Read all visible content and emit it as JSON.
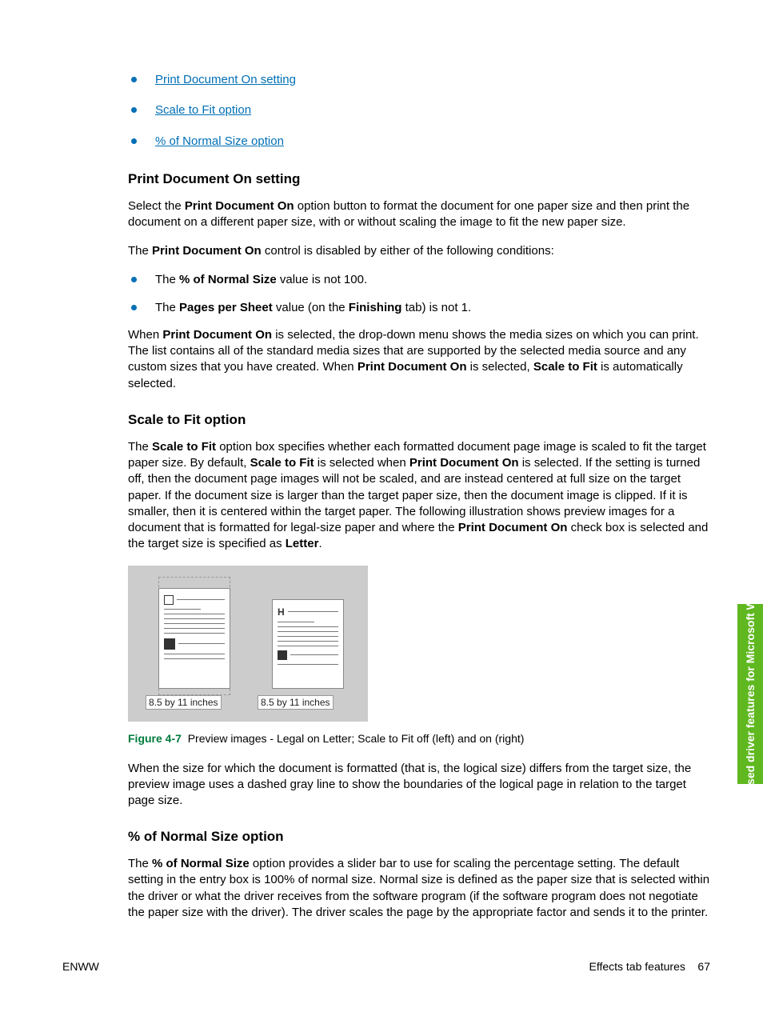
{
  "toc": {
    "items": [
      {
        "label": "Print Document On setting"
      },
      {
        "label": "Scale to Fit option"
      },
      {
        "label": "% of Normal Size option"
      }
    ]
  },
  "section1": {
    "heading": "Print Document On setting",
    "p1_a": "Select the ",
    "p1_b": "Print Document On",
    "p1_c": " option button to format the document for one paper size and then print the document on a different paper size, with or without scaling the image to fit the new paper size.",
    "p2_a": "The ",
    "p2_b": "Print Document On",
    "p2_c": " control is disabled by either of the following conditions:",
    "li1_a": "The ",
    "li1_b": "% of Normal Size",
    "li1_c": " value is not 100.",
    "li2_a": "The ",
    "li2_b": "Pages per Sheet",
    "li2_c": " value (on the ",
    "li2_d": "Finishing",
    "li2_e": " tab) is not 1.",
    "p3_a": "When ",
    "p3_b": "Print Document On",
    "p3_c": " is selected, the drop-down menu shows the media sizes on which you can print. The list contains all of the standard media sizes that are supported by the selected media source and any custom sizes that you have created. When ",
    "p3_d": "Print Document On",
    "p3_e": " is selected, ",
    "p3_f": "Scale to Fit",
    "p3_g": " is automatically selected."
  },
  "section2": {
    "heading": "Scale to Fit option",
    "p1_a": "The ",
    "p1_b": "Scale to Fit",
    "p1_c": " option box specifies whether each formatted document page image is scaled to fit the target paper size. By default, ",
    "p1_d": "Scale to Fit",
    "p1_e": " is selected when ",
    "p1_f": "Print Document On",
    "p1_g": " is selected. If the setting is turned off, then the document page images will not be scaled, and are instead centered at full size on the target paper. If the document size is larger than the target paper size, then the document image is clipped. If it is smaller, then it is centered within the target paper. The following illustration shows preview images for a document that is formatted for legal-size paper and where the ",
    "p1_h": "Print Document On",
    "p1_i": " check box is selected and the target size is specified as ",
    "p1_j": "Letter",
    "p1_k": ".",
    "size_label": "8.5 by 11 inches",
    "fig_num": "Figure 4-7",
    "fig_text": "Preview images - Legal on Letter; Scale to Fit off (left) and on (right)",
    "p2": "When the size for which the document is formatted (that is, the logical size) differs from the target size, the preview image uses a dashed gray line to show the boundaries of the logical page in relation to the target page size."
  },
  "section3": {
    "heading": "% of Normal Size option",
    "p1_a": "The ",
    "p1_b": "% of Normal Size",
    "p1_c": " option provides a slider bar to use for scaling the percentage setting. The default setting in the entry box is 100% of normal size. Normal size is defined as the paper size that is selected within the driver or what the driver receives from the software program (if the software program does not negotiate the paper size with the driver). The driver scales the page by the appropriate factor and sends it to the printer."
  },
  "sidebar": {
    "text": "Host-based driver features for Microsoft Windows"
  },
  "footer": {
    "left": "ENWW",
    "right_label": "Effects tab features",
    "page_no": "67"
  }
}
